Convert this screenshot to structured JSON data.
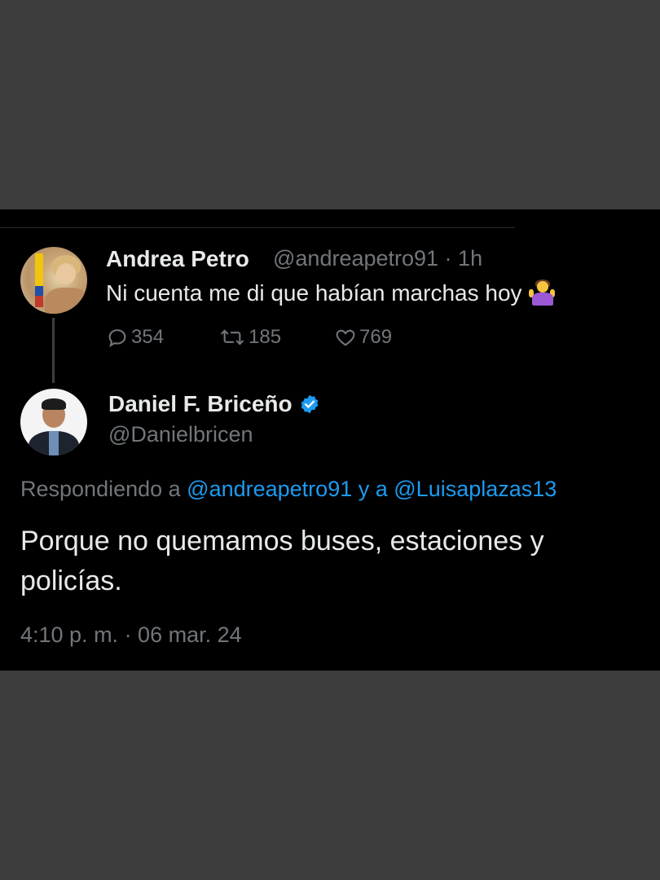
{
  "parent_tweet": {
    "author_name": "Andrea Petro",
    "handle_time": "@andreapetro91 · 1h",
    "text": "Ni cuenta me di que habían marchas hoy",
    "emoji": "person-shrugging-emoji",
    "replies": "354",
    "retweets": "185",
    "likes": "769"
  },
  "reply_tweet": {
    "author_name": "Daniel F. Briceño",
    "handle": "@Danielbricen",
    "replying_prefix": "Respondiendo a ",
    "mention_1": "@andreapetro91",
    "replying_joiner": " y a ",
    "mention_2": "@Luisaplazas13",
    "text": "Porque no quemamos buses, estaciones y policías.",
    "timestamp": "4:10 p. m. · 06 mar. 24"
  },
  "colors": {
    "background_outer": "#3d3d3d",
    "card": "#000000",
    "text_primary": "#e7e9ea",
    "text_secondary": "#71767b",
    "accent": "#1d9bf0"
  }
}
